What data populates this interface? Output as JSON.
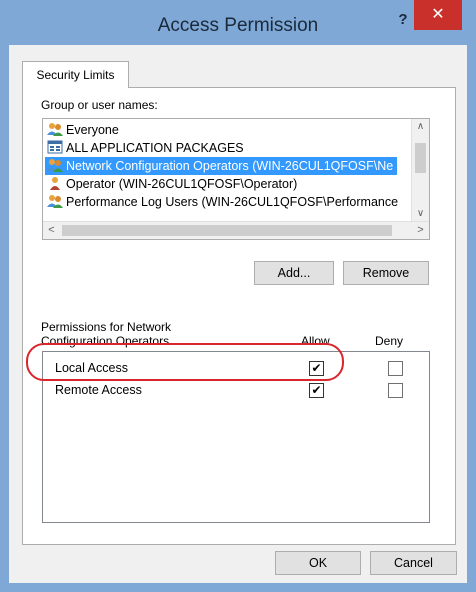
{
  "window": {
    "title": "Access Permission",
    "help_label": "?",
    "close_label": "✕"
  },
  "tab": {
    "label": "Security Limits"
  },
  "users": {
    "label": "Group or user names:",
    "items": [
      {
        "name": "Everyone",
        "icon": "users-group-icon",
        "selected": false
      },
      {
        "name": "ALL APPLICATION PACKAGES",
        "icon": "application-packages-icon",
        "selected": false
      },
      {
        "name": "Network Configuration Operators (WIN-26CUL1QFOSF\\Ne",
        "icon": "users-group-icon",
        "selected": true
      },
      {
        "name": "Operator (WIN-26CUL1QFOSF\\Operator)",
        "icon": "user-icon",
        "selected": false
      },
      {
        "name": "Performance Log Users (WIN-26CUL1QFOSF\\Performance",
        "icon": "users-group-icon",
        "selected": false
      }
    ]
  },
  "buttons": {
    "add": "Add...",
    "remove": "Remove",
    "ok": "OK",
    "cancel": "Cancel"
  },
  "permissions": {
    "header_line1": "Permissions for Network",
    "header_line2": "Configuration Operators",
    "allow_label": "Allow",
    "deny_label": "Deny",
    "rows": [
      {
        "name": "Local Access",
        "allow": true,
        "deny": false
      },
      {
        "name": "Remote Access",
        "allow": true,
        "deny": false
      }
    ]
  },
  "colors": {
    "selection": "#3399ff",
    "close_button": "#c9302c",
    "highlight": "#d9262c",
    "window_frame": "#7fa8d6"
  }
}
